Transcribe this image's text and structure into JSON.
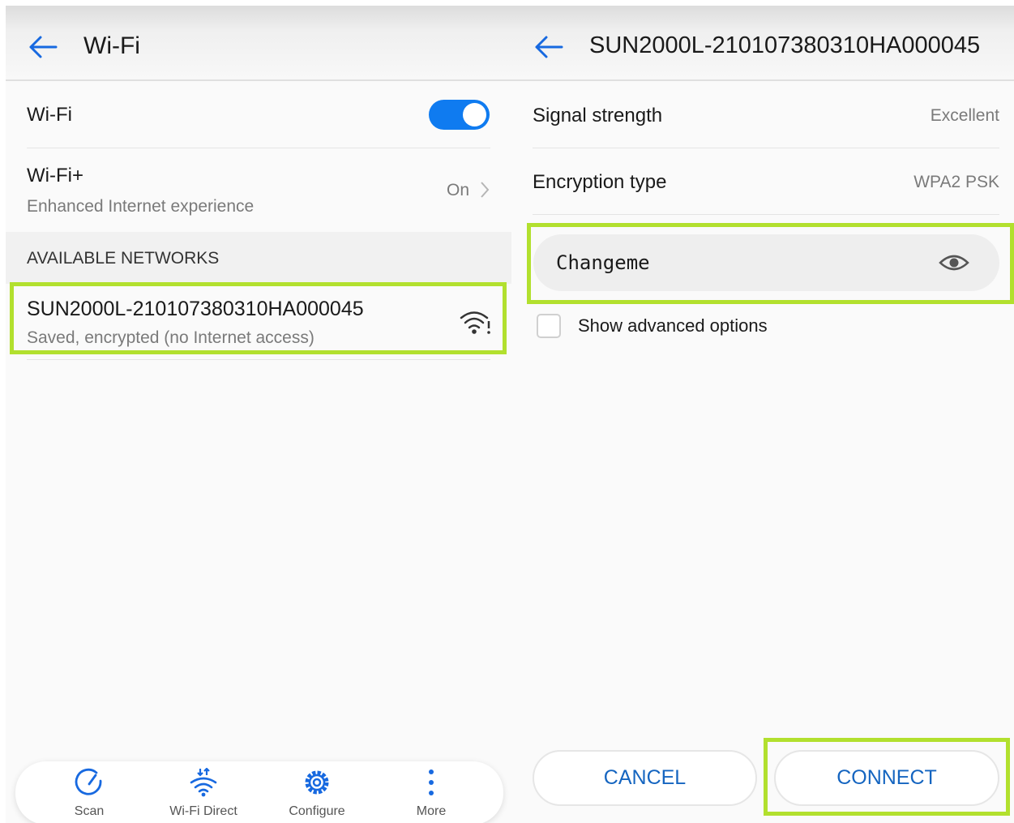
{
  "left": {
    "header": {
      "title": "Wi-Fi",
      "back_icon": "arrow-left-icon"
    },
    "wifi_row": {
      "label": "Wi-Fi",
      "toggle_on": true,
      "toggle_color": "#0f7bf0"
    },
    "wifi_plus": {
      "label": "Wi-Fi+",
      "subtitle": "Enhanced Internet experience",
      "status": "On"
    },
    "section_header": "AVAILABLE NETWORKS",
    "networks": [
      {
        "ssid": "SUN2000L-210107380310HA000045",
        "status": "Saved, encrypted (no Internet access)",
        "icon": "wifi-signal-warning-icon"
      }
    ],
    "toolbar": {
      "items": [
        {
          "label": "Scan",
          "icon": "scan-icon"
        },
        {
          "label": "Wi-Fi Direct",
          "icon": "wifi-direct-icon"
        },
        {
          "label": "Configure",
          "icon": "gear-icon"
        },
        {
          "label": "More",
          "icon": "more-vertical-icon"
        }
      ]
    }
  },
  "right": {
    "header": {
      "title": "SUN2000L-210107380310HA000045",
      "back_icon": "arrow-left-icon"
    },
    "signal": {
      "label": "Signal strength",
      "value": "Excellent"
    },
    "encryption": {
      "label": "Encryption type",
      "value": "WPA2 PSK"
    },
    "password": {
      "value": "Changeme",
      "icon": "eye-icon"
    },
    "advanced": {
      "label": "Show advanced options",
      "checked": false
    },
    "buttons": {
      "cancel": "CANCEL",
      "connect": "CONNECT"
    }
  },
  "colors": {
    "highlight": "#b2e02e",
    "accent": "#0f7bf0",
    "button_text": "#1565c0"
  }
}
